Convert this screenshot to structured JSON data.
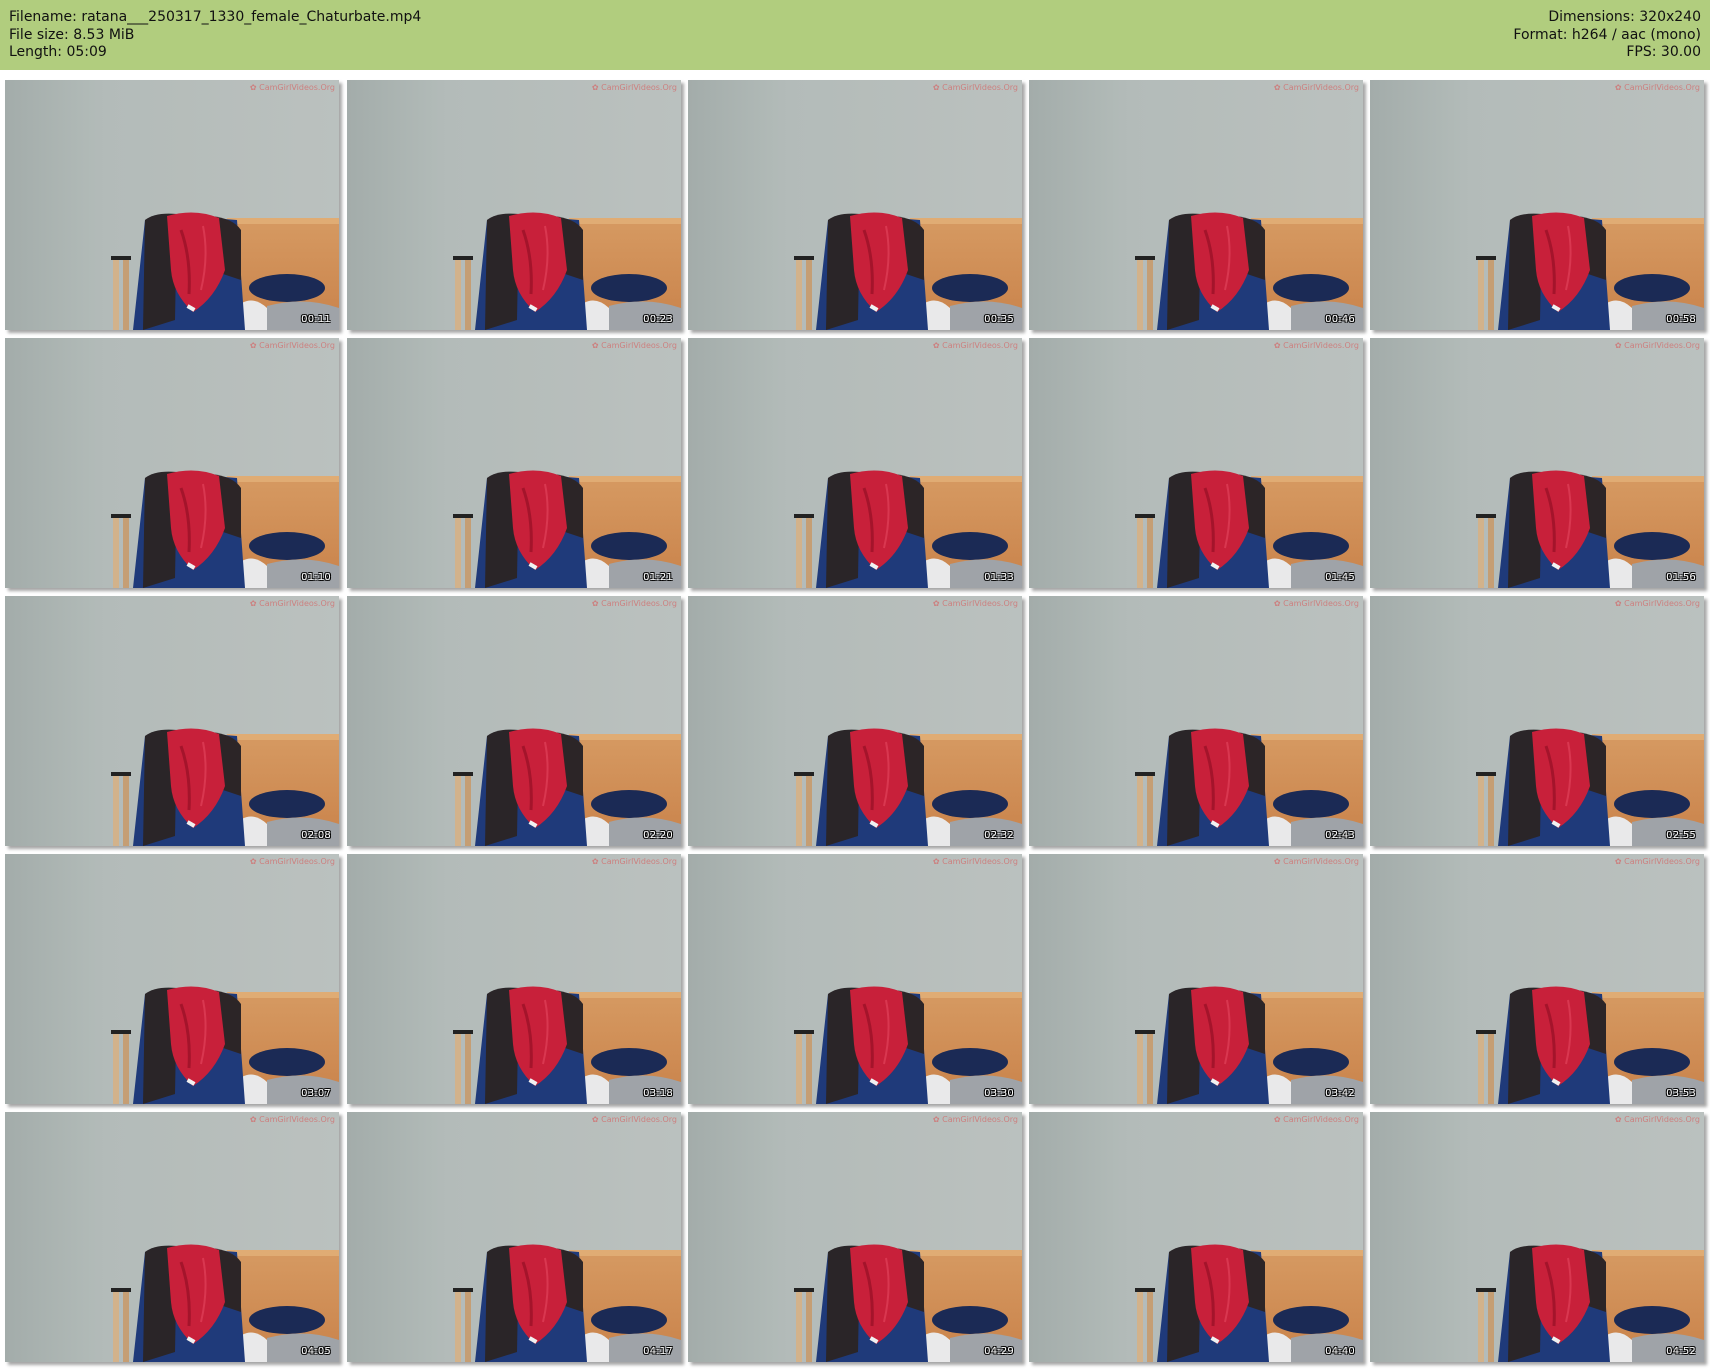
{
  "header": {
    "filename_label": "Filename:",
    "filename": "ratana___250317_1330_female_Chaturbate.mp4",
    "filesize_label": "File size:",
    "filesize": "8.53 MiB",
    "length_label": "Length:",
    "length": "05:09",
    "dimensions_label": "Dimensions:",
    "dimensions": "320x240",
    "format_label": "Format:",
    "format": "h264 / aac (mono)",
    "fps_label": "FPS:",
    "fps": "30.00"
  },
  "colors": {
    "header_bg": "#b1cd7e",
    "wall": "#b9c2bf",
    "cabinet": "#c9824a",
    "red_cloth": "#c8203a",
    "blue_cloth": "#1f3a7a"
  },
  "thumbnails": {
    "watermark_icon": "camgirlvideos-logo-icon",
    "timestamps": [
      "00:11",
      "00:23",
      "00:35",
      "00:46",
      "00:58",
      "01:10",
      "01:21",
      "01:33",
      "01:45",
      "01:56",
      "02:08",
      "02:20",
      "02:32",
      "02:43",
      "02:55",
      "03:07",
      "03:18",
      "03:30",
      "03:42",
      "03:53",
      "04:05",
      "04:17",
      "04:29",
      "04:40",
      "04:52"
    ]
  }
}
